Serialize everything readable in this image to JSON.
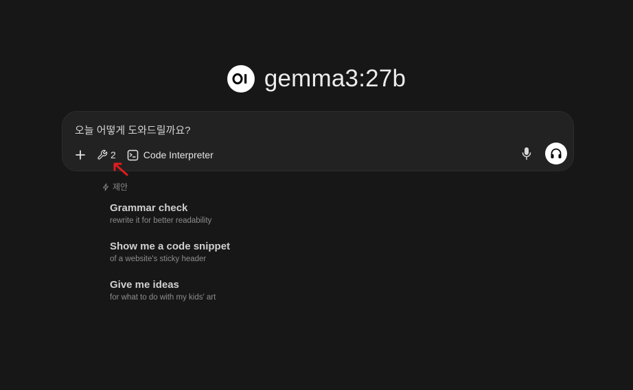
{
  "header": {
    "logo_text": "OI",
    "model_name": "gemma3:27b"
  },
  "chat_input": {
    "placeholder": "오늘 어떻게 도와드릴까요?",
    "tools_count": "2",
    "code_interpreter_label": "Code Interpreter"
  },
  "colors": {
    "background": "#171717",
    "input_bg": "#222222",
    "annotation_arrow": "#e11d1d"
  },
  "suggestions": {
    "header_label": "제안",
    "items": [
      {
        "title": "Grammar check",
        "subtitle": "rewrite it for better readability"
      },
      {
        "title": "Show me a code snippet",
        "subtitle": "of a website's sticky header"
      },
      {
        "title": "Give me ideas",
        "subtitle": "for what to do with my kids' art"
      }
    ]
  }
}
